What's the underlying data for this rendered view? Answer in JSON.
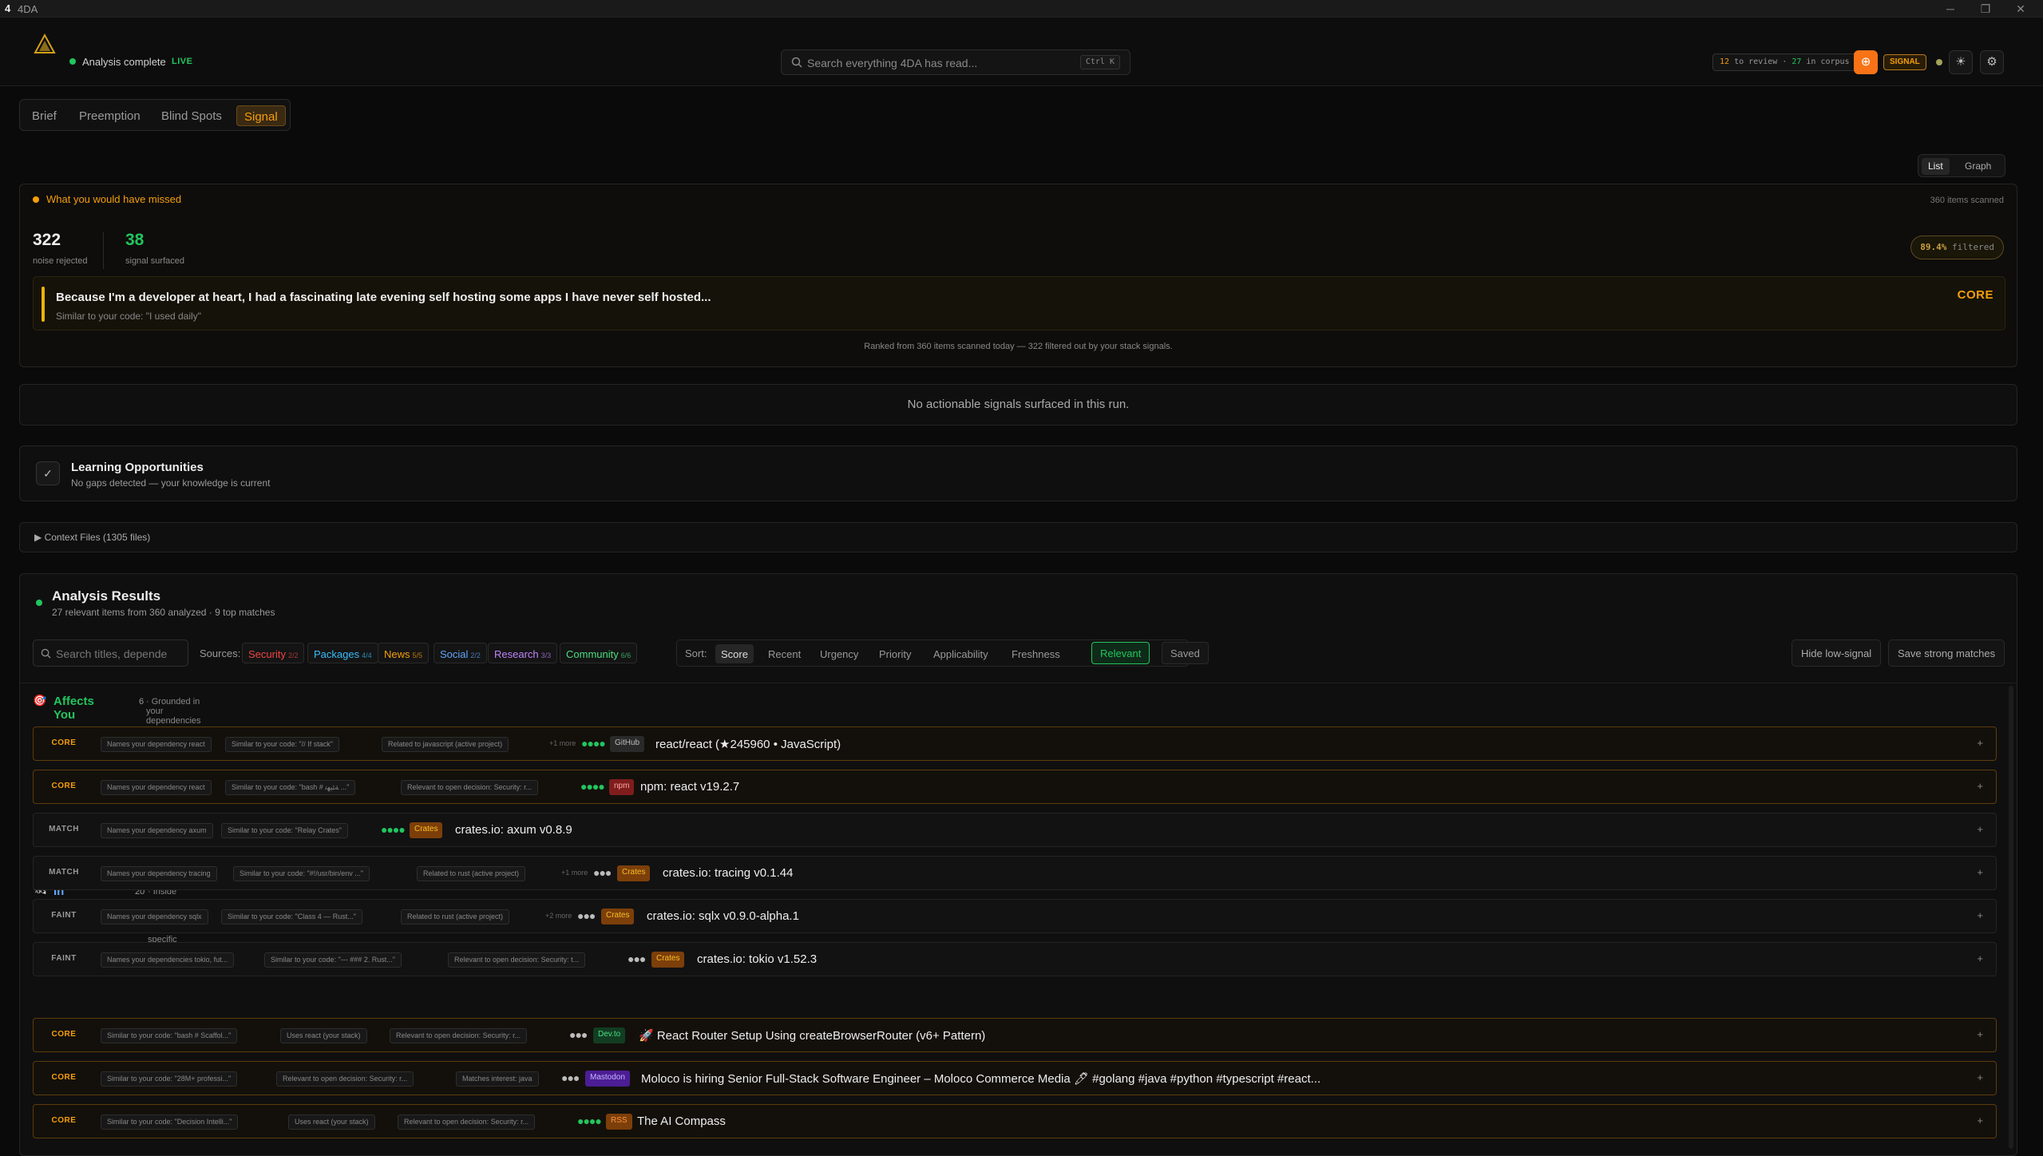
{
  "window": {
    "title": "4DA",
    "icon": "4",
    "controls": [
      "─",
      "❐",
      "✕"
    ]
  },
  "header": {
    "status": "Analysis complete",
    "live": "LIVE",
    "search_placeholder": "Search everything 4DA has read...",
    "search_shortcut": "Ctrl K",
    "review_count": "12",
    "review_text": " to review · ",
    "corpus_count": "27",
    "corpus_text": " in corpus",
    "signal_badge": "SIGNAL"
  },
  "tabs": [
    "Brief",
    "Preemption",
    "Blind Spots",
    "Signal"
  ],
  "active_tab": "Signal",
  "view_toggle": {
    "list": "List",
    "graph": "Graph"
  },
  "missed": {
    "title": "What you would have missed",
    "scanned": "360 items scanned",
    "noise_value": "322",
    "noise_label": "noise rejected",
    "signal_value": "38",
    "signal_label": "signal surfaced",
    "filtered_pct": "89.4%",
    "filtered_label": "filtered",
    "core_title": "Because I'm a developer at heart, I had a fascinating late evening self hosting some apps I have never self hosted...",
    "core_sub": "Similar to your code: \"I used daily\"",
    "core_tag": "CORE",
    "ranked_text": "Ranked from 360 items scanned today — 322 filtered out by your stack signals."
  },
  "no_actionable": "No actionable signals surfaced in this run.",
  "learning": {
    "title": "Learning Opportunities",
    "subtitle": "No gaps detected — your knowledge is current"
  },
  "context_files": "▶ Context Files (1305 files)",
  "results": {
    "title": "Analysis Results",
    "subtitle": "27 relevant items from 360 analyzed · 9 top matches",
    "search_placeholder": "Search titles, depende",
    "sources_label": "Sources:",
    "sources": [
      {
        "name": "Security",
        "count": "2/2",
        "color": "#ef4444"
      },
      {
        "name": "Packages",
        "count": "4/4",
        "color": "#38bdf8"
      },
      {
        "name": "News",
        "count": "5/5",
        "color": "#f59e0b"
      },
      {
        "name": "Social",
        "count": "2/2",
        "color": "#60a5fa"
      },
      {
        "name": "Research",
        "count": "3/3",
        "color": "#c084fc"
      },
      {
        "name": "Community",
        "count": "6/6",
        "color": "#4ade80"
      }
    ],
    "sort_label": "Sort:",
    "sorts": [
      "Score",
      "Recent",
      "Urgency",
      "Priority",
      "Applicability",
      "Freshness"
    ],
    "active_sort": "Score",
    "relevant": "Relevant",
    "saved": "Saved",
    "hide_low": "Hide low-signal",
    "save_strong": "Save strong matches"
  },
  "sections": [
    {
      "icon": "🎯",
      "name": "Affects You",
      "count": "6",
      "desc": "· Grounded in your dependencies",
      "color": "#22c55e"
    },
    {
      "icon": "🛰",
      "name": "In Your Orbit",
      "count": "20",
      "desc": "· Inside your stack — not tied to a specific package",
      "color": "#60a5fa"
    }
  ],
  "rows": [
    {
      "tier": "CORE",
      "pills": [
        "Names your dependency react",
        "Similar to your code: \"// If stack\"",
        "Related to javascript (active project)"
      ],
      "more": "+1 more",
      "dots": "●●●●",
      "dots_color": "#22c55e",
      "source": "GitHub",
      "src_class": "gh",
      "title": "react/react (★245960 • JavaScript)"
    },
    {
      "tier": "CORE",
      "pills": [
        "Names your dependency react",
        "Similar to your code: \"bash # ﺔﺌﻴﻬﺗ ...\"",
        "Relevant to open decision: Security: r..."
      ],
      "more": "",
      "dots": "●●●●",
      "dots_color": "#22c55e",
      "source": "npm",
      "src_class": "npm",
      "title": "npm: react v19.2.7"
    },
    {
      "tier": "MATCH",
      "pills": [
        "Names your dependency axum",
        "Similar to your code: \"Relay Crates\""
      ],
      "more": "",
      "dots": "●●●●",
      "dots_color": "#22c55e",
      "source": "Crates",
      "src_class": "crates",
      "title": "crates.io: axum v0.8.9"
    },
    {
      "tier": "MATCH",
      "pills": [
        "Names your dependency tracing",
        "Similar to your code: \"#!/usr/bin/env ...\"",
        "Related to rust (active project)"
      ],
      "more": "+1 more",
      "dots": "●●●",
      "dots_color": "#bbbbbb",
      "source": "Crates",
      "src_class": "crates",
      "title": "crates.io: tracing v0.1.44"
    },
    {
      "tier": "FAINT",
      "pills": [
        "Names your dependency sqlx",
        "Similar to your code: \"Class 4 — Rust...\"",
        "Related to rust (active project)"
      ],
      "more": "+2 more",
      "dots": "●●●",
      "dots_color": "#bbbbbb",
      "source": "Crates",
      "src_class": "crates",
      "title": "crates.io: sqlx v0.9.0-alpha.1"
    },
    {
      "tier": "FAINT",
      "pills": [
        "Names your dependencies tokio, fut...",
        "Similar to your code: \"--- ### 2. Rust...\"",
        "Relevant to open decision: Security: t..."
      ],
      "more": "",
      "dots": "●●●",
      "dots_color": "#bbbbbb",
      "source": "Crates",
      "src_class": "crates",
      "title": "crates.io: tokio v1.52.3"
    },
    {
      "tier": "CORE",
      "pills": [
        "Similar to your code: \"bash # Scaffol...\"",
        "Uses react (your stack)",
        "Relevant to open decision: Security: r..."
      ],
      "more": "",
      "dots": "●●●",
      "dots_color": "#bbbbbb",
      "source": "Dev.to",
      "src_class": "devto",
      "title": "🚀 React Router Setup Using createBrowserRouter (v6+ Pattern)"
    },
    {
      "tier": "CORE",
      "pills": [
        "Similar to your code: \"28M+ professi...\"",
        "Relevant to open decision: Security: r...",
        "Matches interest: java"
      ],
      "more": "",
      "dots": "●●●",
      "dots_color": "#bbbbbb",
      "source": "Mastodon",
      "src_class": "mast",
      "title": "Moloco is hiring Senior Full-Stack Software Engineer – Moloco Commerce Media 🖊 #golang #java #python #typescript #react..."
    },
    {
      "tier": "CORE",
      "pills": [
        "Similar to your code: \"Decision Intelli...\"",
        "Uses react (your stack)",
        "Relevant to open decision: Security: r..."
      ],
      "more": "",
      "dots": "●●●●",
      "dots_color": "#22c55e",
      "source": "RSS",
      "src_class": "rss",
      "title": "The AI Compass"
    }
  ]
}
